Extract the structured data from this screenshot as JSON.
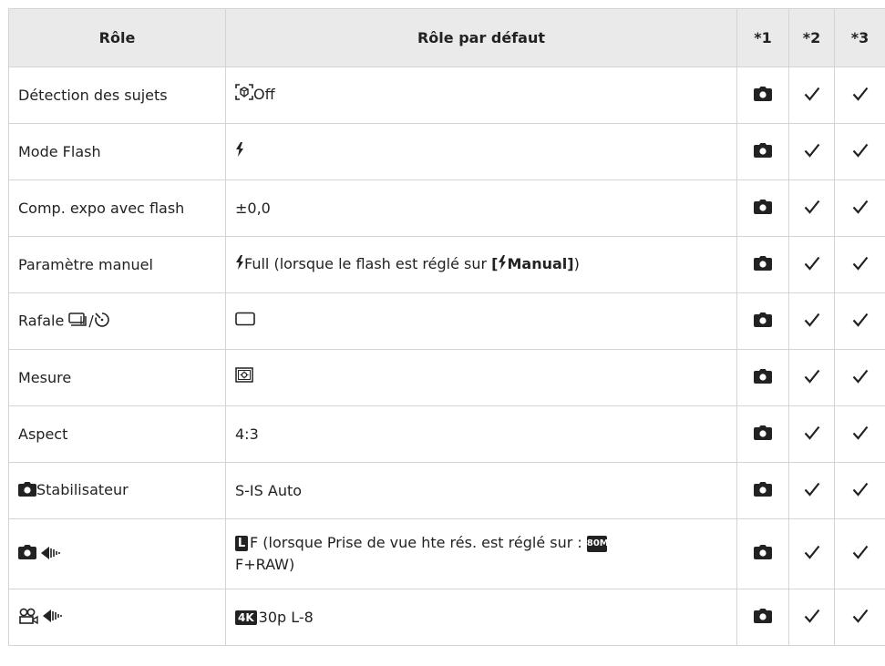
{
  "header": {
    "col_role": "Rôle",
    "col_default": "Rôle par défaut",
    "col_1": "*1",
    "col_2": "*2",
    "col_3": "*3"
  },
  "rows": [
    {
      "role": "Détection des sujets",
      "default": "Off"
    },
    {
      "role": "Mode Flash",
      "default": ""
    },
    {
      "role": "Comp. expo avec flash",
      "default": "±0,0"
    },
    {
      "role": "Paramètre manuel",
      "default_a": "Full (lorsque le flash est réglé sur ",
      "default_b": "[",
      "default_c": "Manual]",
      "default_d": ")"
    },
    {
      "role": "Rafale ",
      "role_sep": "/",
      "default": ""
    },
    {
      "role": "Mesure",
      "default": ""
    },
    {
      "role": "Aspect",
      "default": "4:3"
    },
    {
      "role": "Stabilisateur",
      "default": "S-IS Auto"
    },
    {
      "role": "",
      "default_badge": "L",
      "default_a": "F (lorsque Prise de vue hte rés. est réglé sur : ",
      "default_mbadge": "80M",
      "default_b": "F+RAW)"
    },
    {
      "role": "",
      "default_badge": "4K",
      "default_a": "30p L-8"
    }
  ],
  "icons": {
    "camera": "camera-icon",
    "check": "check-icon",
    "flash": "flash-icon",
    "subject": "subject-detection-icon",
    "burst": "burst-icon",
    "timer": "self-timer-icon",
    "single": "single-frame-icon",
    "metering": "metering-icon",
    "quality": "image-quality-icon",
    "movie": "movie-icon"
  }
}
